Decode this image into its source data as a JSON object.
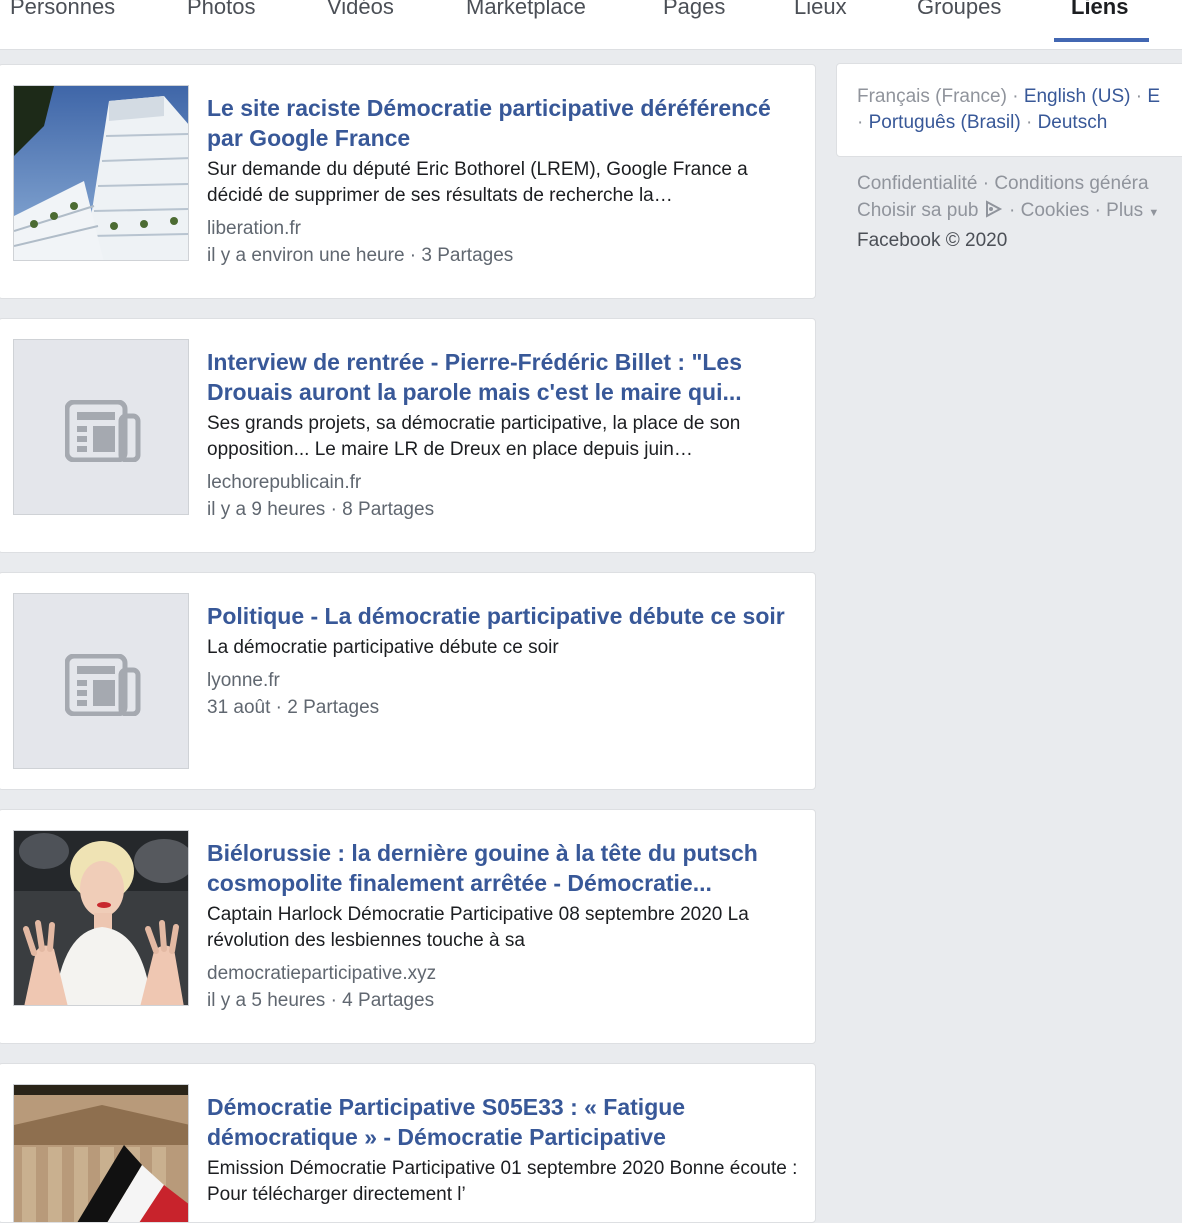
{
  "tabs": [
    {
      "label": "Personnes"
    },
    {
      "label": "Photos"
    },
    {
      "label": "Vidéos"
    },
    {
      "label": "Marketplace"
    },
    {
      "label": "Pages"
    },
    {
      "label": "Lieux"
    },
    {
      "label": "Groupes"
    },
    {
      "label": "Liens"
    }
  ],
  "active_tab": "Liens",
  "results": [
    {
      "title": "Le site raciste Démocratie participative déréférencé par Google France",
      "description": "Sur demande du député Eric Bothorel (LREM), Google France a décidé de supprimer de ses résultats de recherche la…",
      "domain": "liberation.fr",
      "meta": "il y a environ une heure · 3 Partages",
      "thumbnail": "building-photo"
    },
    {
      "title": "Interview de rentrée - Pierre-Frédéric Billet : \"Les Drouais auront la parole mais c'est le maire qui...",
      "description": "Ses grands projets, sa démocratie participative, la place de son opposition... Le maire LR de Dreux en place depuis juin…",
      "domain": "lechorepublicain.fr",
      "meta": "il y a 9 heures · 8 Partages",
      "thumbnail": "newspaper-icon"
    },
    {
      "title": "Politique - La démocratie participative débute ce soir",
      "description": "La démocratie participative débute ce soir",
      "domain": "lyonne.fr",
      "meta": "31 août · 2 Partages",
      "thumbnail": "newspaper-icon"
    },
    {
      "title": "Biélorussie : la dernière gouine à la tête du putsch cosmopolite finalement arrêtée - Démocratie...",
      "description": "Captain Harlock Démocratie Participative 08 septembre 2020 La révolution des lesbiennes touche à sa",
      "domain": "democratieparticipative.xyz",
      "meta": "il y a 5 heures · 4 Partages",
      "thumbnail": "woman-photo"
    },
    {
      "title": "Démocratie Participative S05E33 : « Fatigue démocratique » - Démocratie Participative",
      "description": "Emission Démocratie Participative 01 septembre 2020 Bonne écoute : Pour télécharger directement l’",
      "domain": "",
      "meta": "",
      "thumbnail": "flag-photo"
    }
  ],
  "languages": {
    "current": "Français (France)",
    "links": [
      "English (US)",
      "E",
      "Português (Brasil)",
      "Deutsch"
    ]
  },
  "footer": {
    "confidentialite": "Confidentialité",
    "conditions": "Conditions généra",
    "choisir": "Choisir sa pub",
    "cookies": "Cookies",
    "plus": "Plus",
    "copyright": "Facebook © 2020"
  },
  "colors": {
    "link_blue": "#385898",
    "tab_accent": "#4267b2",
    "page_bg": "#e9ebee"
  }
}
